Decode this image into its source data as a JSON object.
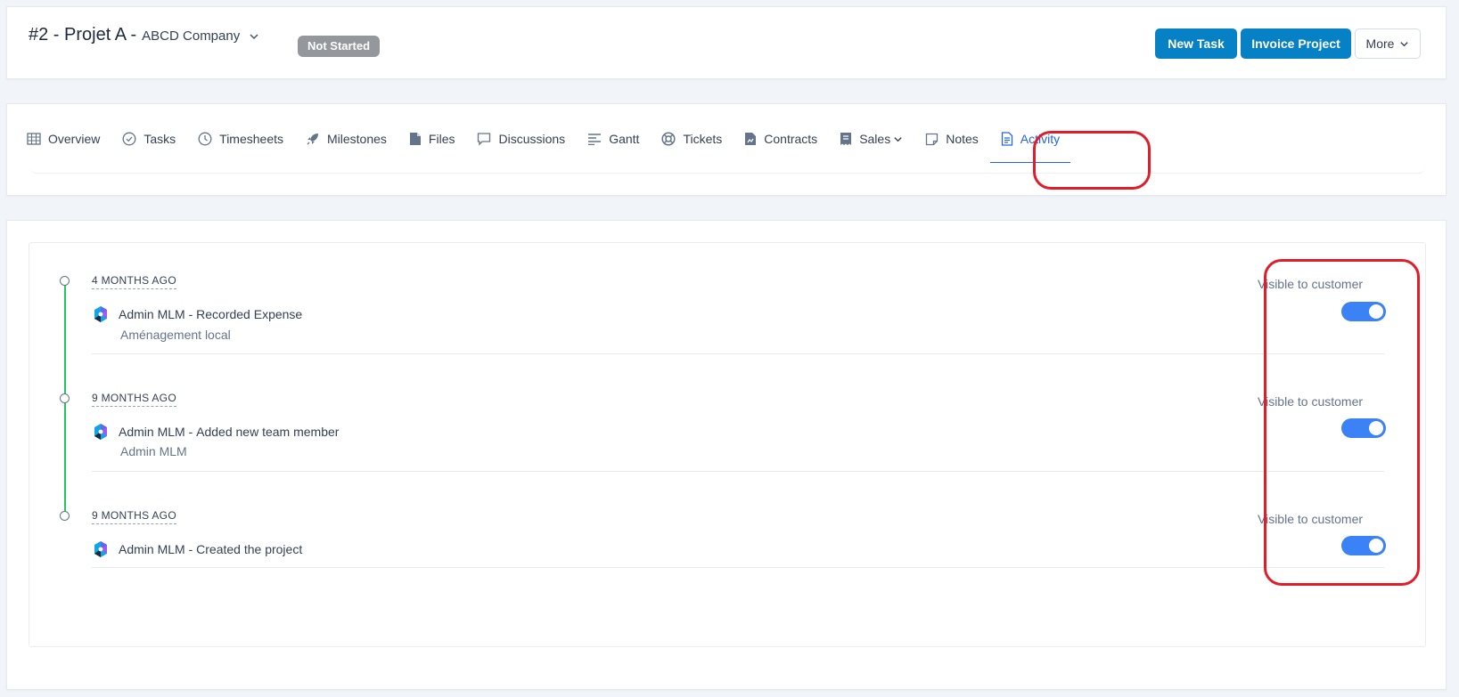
{
  "header": {
    "project_title": "#2 - Projet A -",
    "company": "ABCD Company",
    "status_badge": "Not Started",
    "new_task_label": "New Task",
    "invoice_project_label": "Invoice Project",
    "more_label": "More"
  },
  "tabs": [
    {
      "label": "Overview",
      "icon": "grid-icon"
    },
    {
      "label": "Tasks",
      "icon": "check-circle-icon"
    },
    {
      "label": "Timesheets",
      "icon": "clock-icon"
    },
    {
      "label": "Milestones",
      "icon": "rocket-icon"
    },
    {
      "label": "Files",
      "icon": "file-icon"
    },
    {
      "label": "Discussions",
      "icon": "chat-icon"
    },
    {
      "label": "Gantt",
      "icon": "align-left-icon"
    },
    {
      "label": "Tickets",
      "icon": "life-ring-icon"
    },
    {
      "label": "Contracts",
      "icon": "contract-icon"
    },
    {
      "label": "Sales",
      "icon": "receipt-icon"
    },
    {
      "label": "Notes",
      "icon": "sticky-note-icon"
    },
    {
      "label": "Activity",
      "icon": "document-icon"
    }
  ],
  "active_tab": "Activity",
  "activity": [
    {
      "time": "4 MONTHS AGO",
      "user": "Admin MLM",
      "action": "Recorded Expense",
      "detail": "Aménagement local",
      "visible_label": "Visible to customer",
      "visible": true
    },
    {
      "time": "9 MONTHS AGO",
      "user": "Admin MLM",
      "action": "Added new team member",
      "detail": "Admin MLM",
      "visible_label": "Visible to customer",
      "visible": true
    },
    {
      "time": "9 MONTHS AGO",
      "user": "Admin MLM",
      "action": "Created the project",
      "detail": "",
      "visible_label": "Visible to customer",
      "visible": true
    }
  ],
  "colors": {
    "primary": "#0781c6",
    "active_tab": "#2563eb",
    "toggle_on": "#3b82f6",
    "timeline": "#22c55e",
    "highlight": "#e11d2a",
    "badge_bg": "#94979c"
  }
}
